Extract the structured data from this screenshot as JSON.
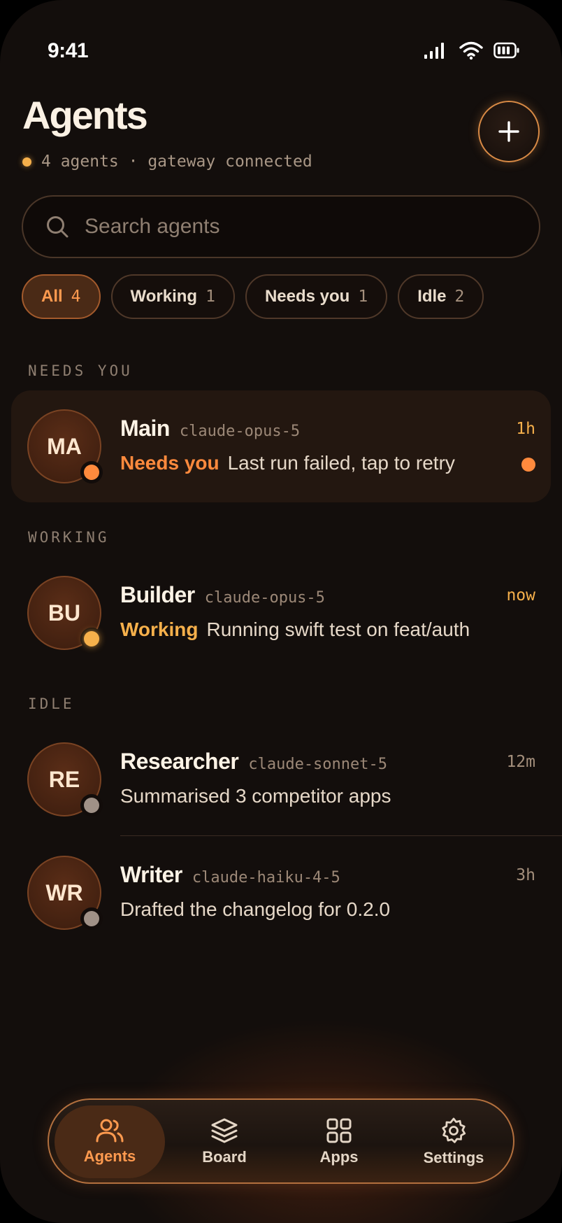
{
  "status_bar": {
    "time": "9:41"
  },
  "header": {
    "title": "Agents",
    "subtitle": "4 agents · gateway connected",
    "add_icon": "plus-icon"
  },
  "search": {
    "placeholder": "Search agents",
    "icon": "search-icon"
  },
  "filters": [
    {
      "label": "All",
      "count": "4",
      "active": true
    },
    {
      "label": "Working",
      "count": "1",
      "active": false
    },
    {
      "label": "Needs you",
      "count": "1",
      "active": false
    },
    {
      "label": "Idle",
      "count": "2",
      "active": false
    }
  ],
  "sections": {
    "needs_you": "NEEDS YOU",
    "working": "WORKING",
    "idle": "IDLE"
  },
  "agents": [
    {
      "initials": "MA",
      "name": "Main",
      "model": "claude-opus-5",
      "ago": "1h",
      "state": "Needs you",
      "state_color": "#ff8a3d",
      "message": "Last run failed, tap to retry",
      "unread": true,
      "ago_color": "#f6b04b"
    },
    {
      "initials": "BU",
      "name": "Builder",
      "model": "claude-opus-5",
      "ago": "now",
      "state": "Working",
      "state_color": "#f6b04b",
      "message": "Running swift test on feat/auth",
      "unread": false,
      "ago_color": "#f6b04b"
    },
    {
      "initials": "RE",
      "name": "Researcher",
      "model": "claude-sonnet-5",
      "ago": "12m",
      "state": "",
      "state_color": "#a09187",
      "message": "Summarised 3 competitor apps",
      "unread": false,
      "ago_color": "#a48f7c"
    },
    {
      "initials": "WR",
      "name": "Writer",
      "model": "claude-haiku-4-5",
      "ago": "3h",
      "state": "",
      "state_color": "#a09187",
      "message": "Drafted the changelog for 0.2.0",
      "unread": false,
      "ago_color": "#a48f7c"
    }
  ],
  "tabbar": [
    {
      "label": "Agents",
      "icon": "users-icon",
      "active": true
    },
    {
      "label": "Board",
      "icon": "layers-icon",
      "active": false
    },
    {
      "label": "Apps",
      "icon": "grid-icon",
      "active": false
    },
    {
      "label": "Settings",
      "icon": "gear-icon",
      "active": false
    }
  ],
  "colors": {
    "accent": "#ff8a3d",
    "working": "#f6b04b",
    "idle": "#a09187",
    "background": "#130e0c"
  }
}
